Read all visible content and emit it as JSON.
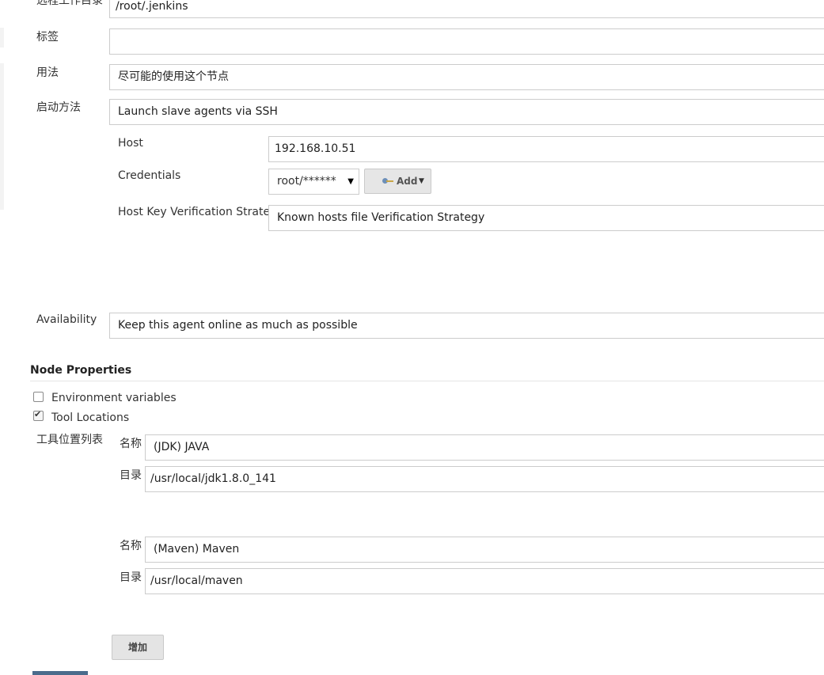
{
  "fields": {
    "remote_root": {
      "label": "远程工作目录",
      "value": "/root/.jenkins"
    },
    "labels": {
      "label": "标签",
      "value": ""
    },
    "usage": {
      "label": "用法",
      "value": "尽可能的使用这个节点"
    },
    "launch_method": {
      "label": "启动方法",
      "value": "Launch slave agents via SSH"
    },
    "host": {
      "label": "Host",
      "value": "192.168.10.51"
    },
    "credentials": {
      "label": "Credentials",
      "value": "root/******",
      "add_label": "Add"
    },
    "host_key": {
      "label": "Host Key Verification Strategy",
      "value": "Known hosts file Verification Strategy"
    },
    "availability": {
      "label": "Availability",
      "value": "Keep this agent online as much as possible"
    }
  },
  "node_properties": {
    "title": "Node Properties",
    "env_vars": {
      "label": "Environment variables",
      "checked": false
    },
    "tool_locations": {
      "label": "Tool Locations",
      "checked": true
    },
    "list_label": "工具位置列表",
    "tools": [
      {
        "name_label": "名称",
        "name": "(JDK) JAVA",
        "dir_label": "目录",
        "dir": "/usr/local/jdk1.8.0_141"
      },
      {
        "name_label": "名称",
        "name": "(Maven) Maven",
        "dir_label": "目录",
        "dir": "/usr/local/maven"
      }
    ],
    "add_button": "增加"
  }
}
